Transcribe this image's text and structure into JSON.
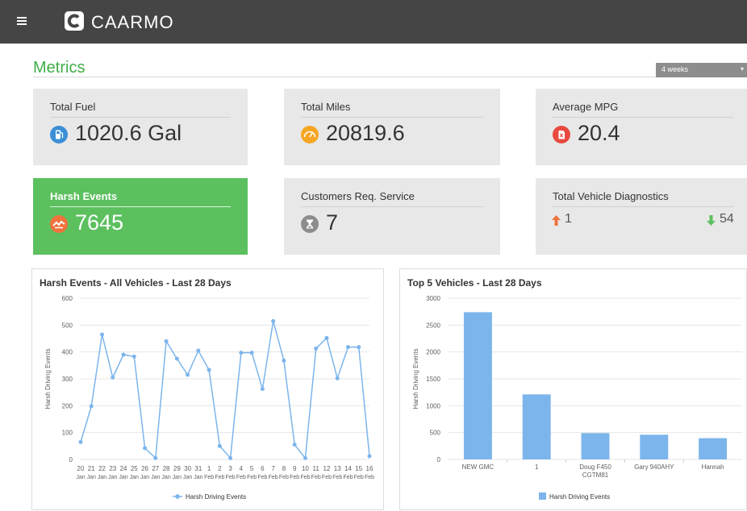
{
  "header": {
    "brand": "CAARMO",
    "menu_icon": "hamburger-menu-icon",
    "logo_icon": "caarmo-logo-icon"
  },
  "metrics": {
    "title": "Metrics",
    "period": "4 weeks"
  },
  "cards": {
    "total_fuel": {
      "label": "Total Fuel",
      "value": "1020.6  Gal",
      "icon": "fuel-pump-icon",
      "icon_color": "#3b8fd6"
    },
    "total_miles": {
      "label": "Total Miles",
      "value": "20819.6",
      "icon": "speedometer-icon",
      "icon_color": "#f5a623"
    },
    "average_mpg": {
      "label": "Average MPG",
      "value": "20.4",
      "icon": "fuel-can-icon",
      "icon_color": "#e84a3f"
    },
    "harsh_events": {
      "label": "Harsh Events",
      "value": "7645",
      "icon": "harsh-event-icon",
      "icon_color": "#f0723c"
    },
    "customers_req_service": {
      "label": "Customers Req. Service",
      "value": "7",
      "icon": "hourglass-icon",
      "icon_color": "#8d8d8d"
    },
    "total_vehicle_diagnostics": {
      "label": "Total Vehicle Diagnostics",
      "up_value": "1",
      "down_value": "54",
      "up_icon": "arrow-up-icon",
      "down_icon": "arrow-down-icon",
      "up_color": "#f0723c",
      "down_color": "#5cc05f"
    }
  },
  "chart_data": [
    {
      "type": "line",
      "title": "Harsh Events - All Vehicles - Last 28 Days",
      "ylabel": "Harsh Driving Events",
      "xlabel": "",
      "ylim": [
        0,
        600
      ],
      "yticks": [
        "0",
        "100",
        "200",
        "300",
        "400",
        "500",
        "600"
      ],
      "categories": [
        [
          "20",
          "Jan"
        ],
        [
          "21",
          "Jan"
        ],
        [
          "22",
          "Jan"
        ],
        [
          "23",
          "Jan"
        ],
        [
          "24",
          "Jan"
        ],
        [
          "25",
          "Jan"
        ],
        [
          "26",
          "Jan"
        ],
        [
          "27",
          "Jan"
        ],
        [
          "28",
          "Jan"
        ],
        [
          "29",
          "Jan"
        ],
        [
          "30",
          "Jan"
        ],
        [
          "31",
          "Jan"
        ],
        [
          "1",
          "Feb"
        ],
        [
          "2",
          "Feb"
        ],
        [
          "3",
          "Feb"
        ],
        [
          "4",
          "Feb"
        ],
        [
          "5",
          "Feb"
        ],
        [
          "6",
          "Feb"
        ],
        [
          "7",
          "Feb"
        ],
        [
          "8",
          "Feb"
        ],
        [
          "9",
          "Feb"
        ],
        [
          "10",
          "Feb"
        ],
        [
          "11",
          "Feb"
        ],
        [
          "12",
          "Feb"
        ],
        [
          "13",
          "Feb"
        ],
        [
          "14",
          "Feb"
        ],
        [
          "15",
          "Feb"
        ],
        [
          "16",
          "Feb"
        ]
      ],
      "series": [
        {
          "name": "Harsh Driving Events",
          "color": "#7cb5ec",
          "values": [
            65,
            198,
            465,
            305,
            390,
            383,
            42,
            5,
            440,
            375,
            315,
            405,
            333,
            50,
            5,
            397,
            397,
            262,
            515,
            368,
            55,
            5,
            413,
            452,
            302,
            418,
            418,
            12
          ]
        }
      ],
      "legend": "bottom-center",
      "grid": true
    },
    {
      "type": "bar",
      "title": "Top 5 Vehicles - Last 28 Days",
      "ylabel": "Harsh Driving Events",
      "xlabel": "",
      "ylim": [
        0,
        3000
      ],
      "yticks": [
        "0",
        "500",
        "1000",
        "1500",
        "2000",
        "2500",
        "3000"
      ],
      "categories": [
        [
          "NEW GMC"
        ],
        [
          "1"
        ],
        [
          "Doug F450",
          "CGTM81"
        ],
        [
          "Gary 940AHY"
        ],
        [
          "Hannah"
        ]
      ],
      "series": [
        {
          "name": "Harsh Driving Events",
          "color": "#7cb5ec",
          "values": [
            2740,
            1210,
            490,
            460,
            395
          ]
        }
      ],
      "legend": "bottom-center",
      "grid": true
    }
  ]
}
